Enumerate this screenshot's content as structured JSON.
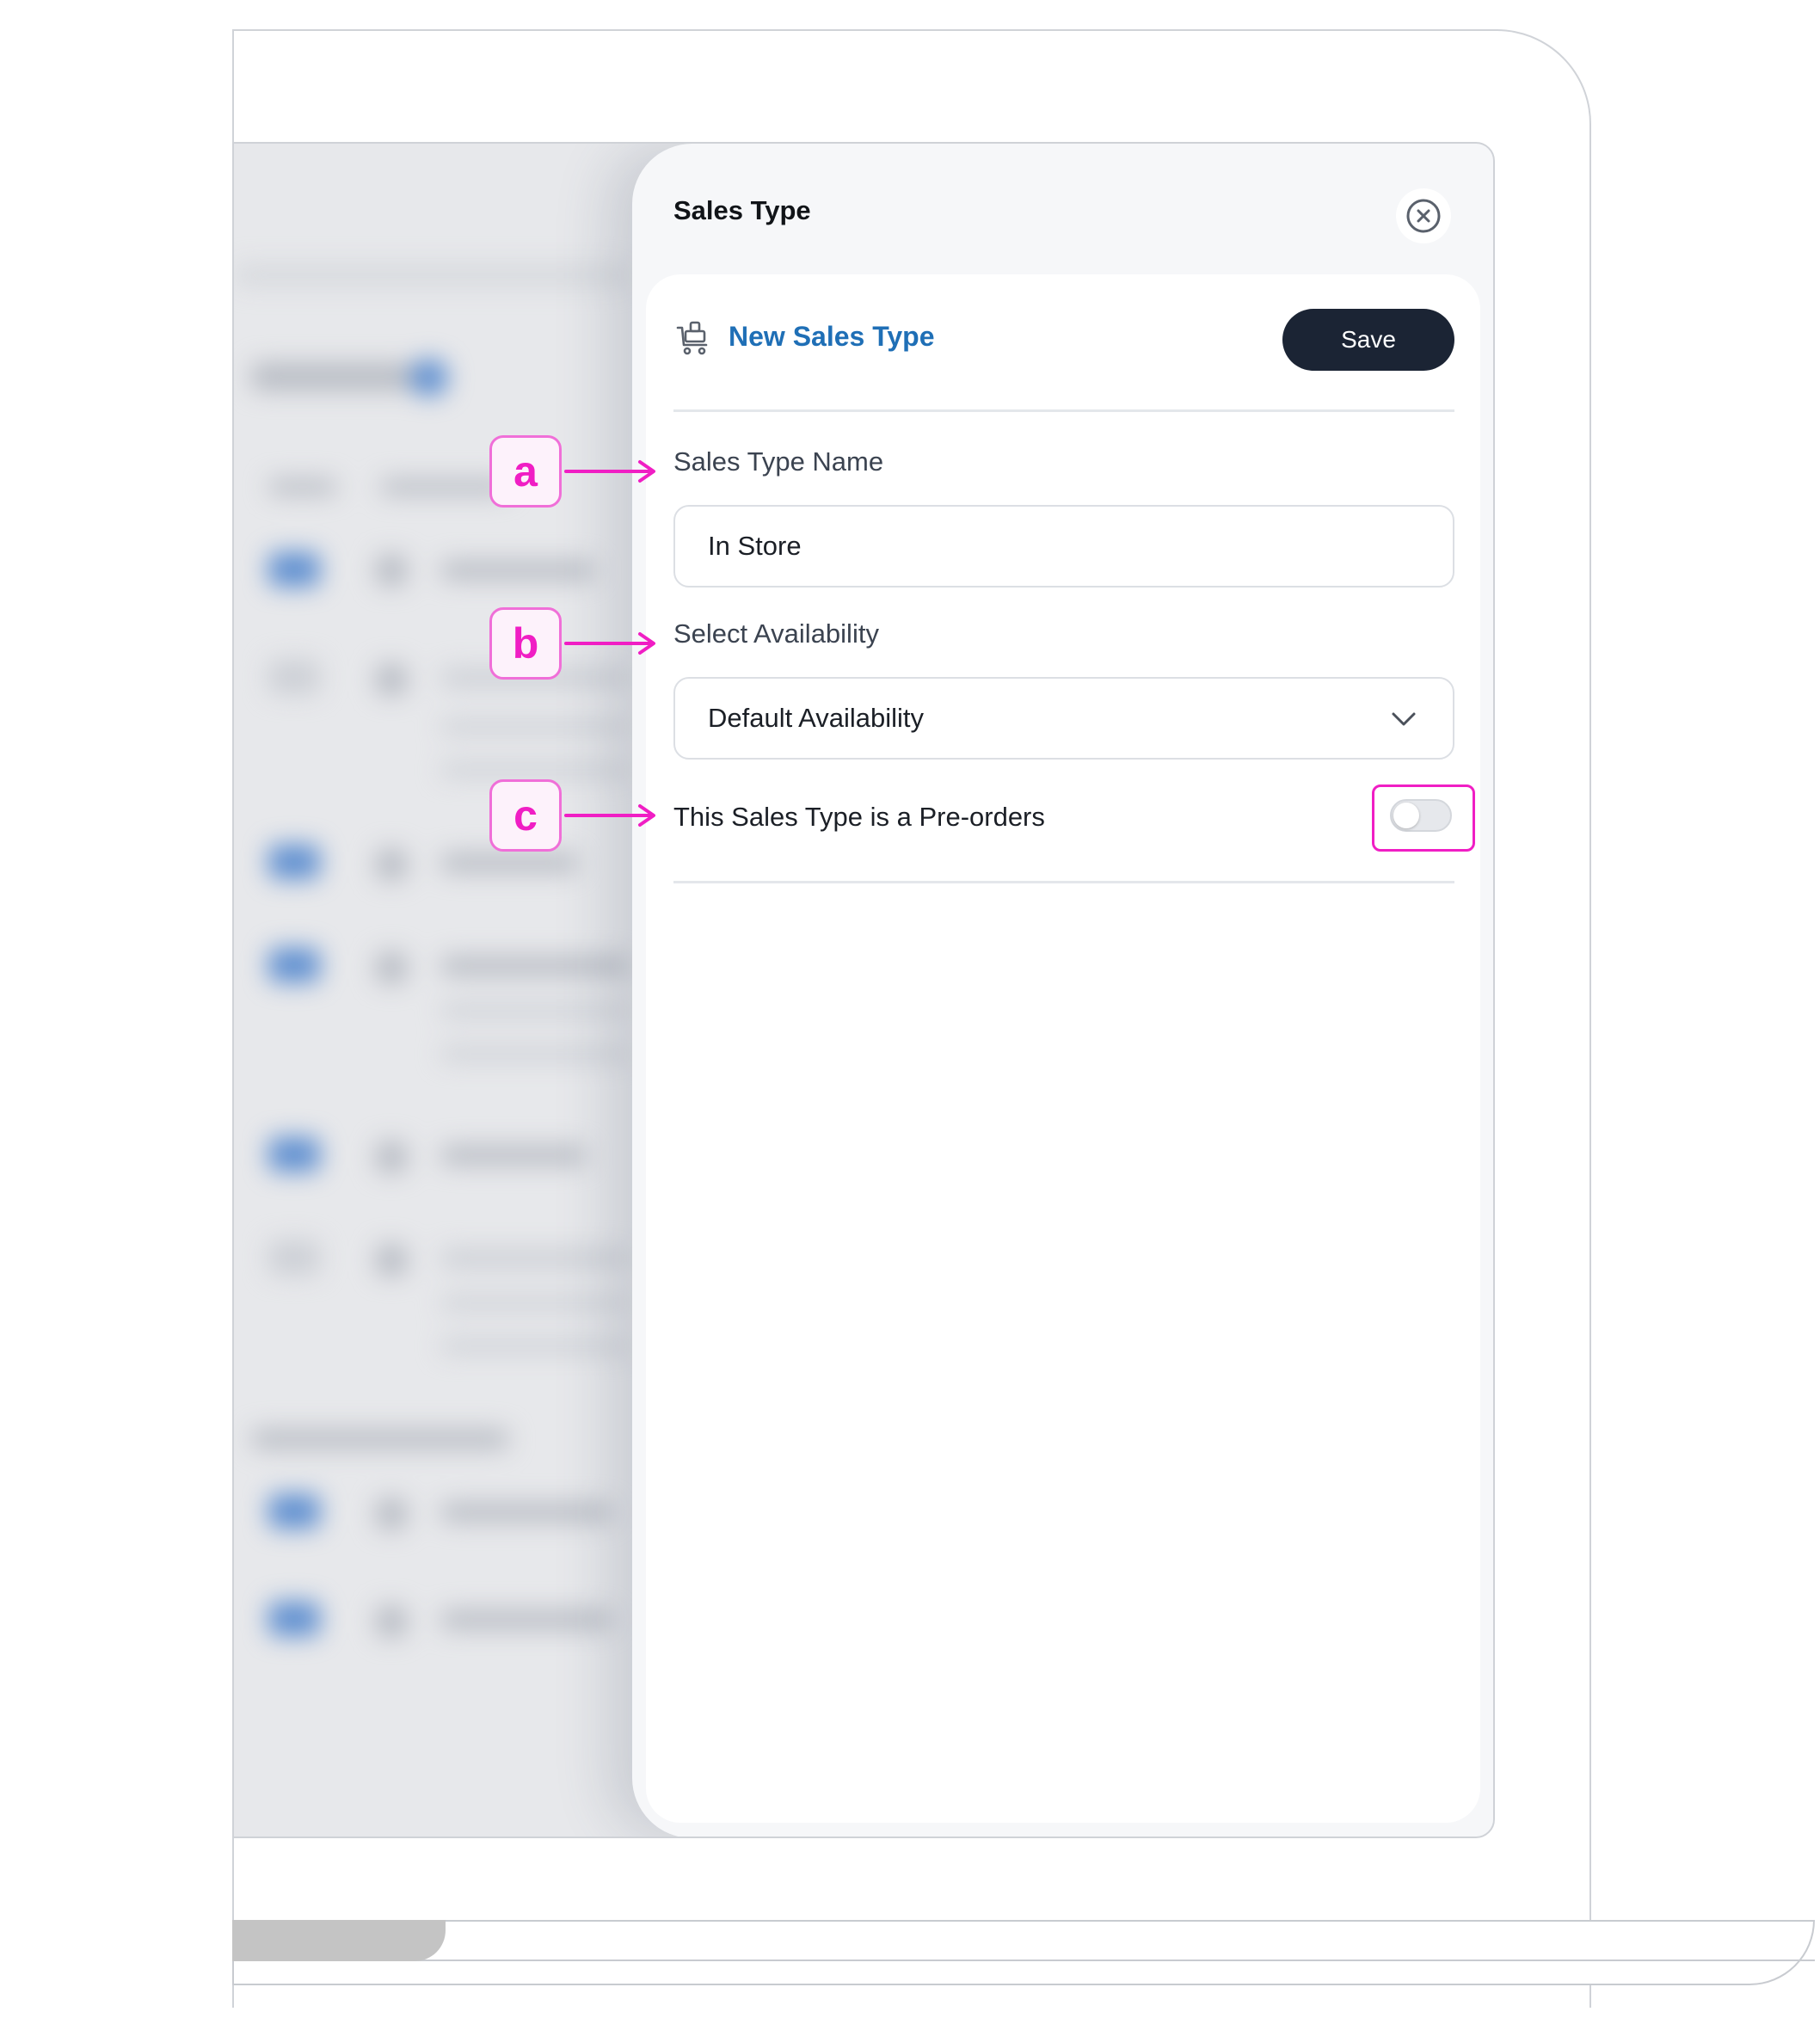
{
  "panel": {
    "title": "Sales Type",
    "close_icon": "close-circle-icon"
  },
  "card": {
    "header_icon": "cart-icon",
    "header_title": "New Sales Type",
    "save_label": "Save"
  },
  "form": {
    "name_label": "Sales Type Name",
    "name_value": "In Store",
    "availability_label": "Select Availability",
    "availability_value": "Default Availability",
    "preorder_label": "This Sales Type is a Pre-orders",
    "preorder_enabled": false
  },
  "annotations": {
    "a": "a",
    "b": "b",
    "c": "c",
    "color": "#f01ec4"
  },
  "colors": {
    "accent": "#1f6fb6",
    "button_dark": "#1b2434"
  }
}
